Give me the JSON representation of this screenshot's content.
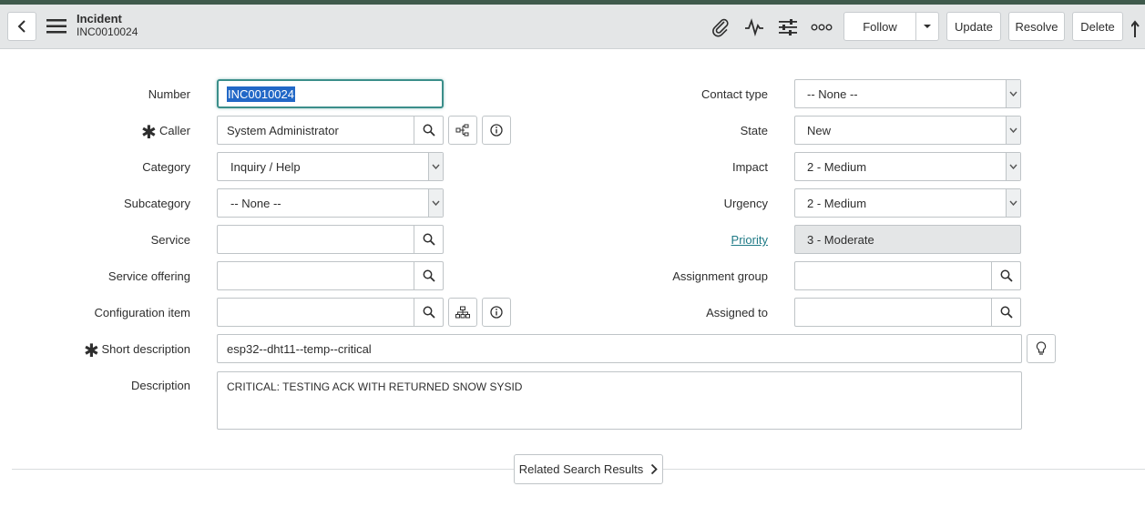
{
  "header": {
    "title": "Incident",
    "subtitle": "INC0010024",
    "icons": [
      "back-icon",
      "menu-icon",
      "paperclip-icon",
      "activity-icon",
      "settings-sliders-icon",
      "more-icon",
      "chevron-down-icon"
    ],
    "buttons": {
      "follow": "Follow",
      "update": "Update",
      "resolve": "Resolve",
      "delete": "Delete"
    }
  },
  "form": {
    "number": {
      "label": "Number",
      "value": "INC0010024"
    },
    "caller": {
      "label": "Caller",
      "value": "System Administrator"
    },
    "category": {
      "label": "Category",
      "value": "Inquiry / Help"
    },
    "subcategory": {
      "label": "Subcategory",
      "value": "-- None --"
    },
    "service": {
      "label": "Service",
      "value": ""
    },
    "service_offering": {
      "label": "Service offering",
      "value": ""
    },
    "configuration_item": {
      "label": "Configuration item",
      "value": ""
    },
    "short_description": {
      "label": "Short description",
      "value": "esp32--dht11--temp--critical"
    },
    "description": {
      "label": "Description",
      "value": "CRITICAL: TESTING ACK WITH RETURNED SNOW SYSID"
    },
    "contact_type": {
      "label": "Contact type",
      "value": "-- None --"
    },
    "state": {
      "label": "State",
      "value": "New"
    },
    "impact": {
      "label": "Impact",
      "value": "2 - Medium"
    },
    "urgency": {
      "label": "Urgency",
      "value": "2 - Medium"
    },
    "priority": {
      "label": "Priority",
      "value": "3 - Moderate"
    },
    "assignment_group": {
      "label": "Assignment group",
      "value": ""
    },
    "assigned_to": {
      "label": "Assigned to",
      "value": ""
    }
  },
  "related_search": {
    "label": "Related Search Results"
  },
  "colors": {
    "accent": "#1f7a86",
    "header_bg": "#e4e6e7",
    "top_strip": "#3f5a4c",
    "selection": "#2268c7"
  }
}
